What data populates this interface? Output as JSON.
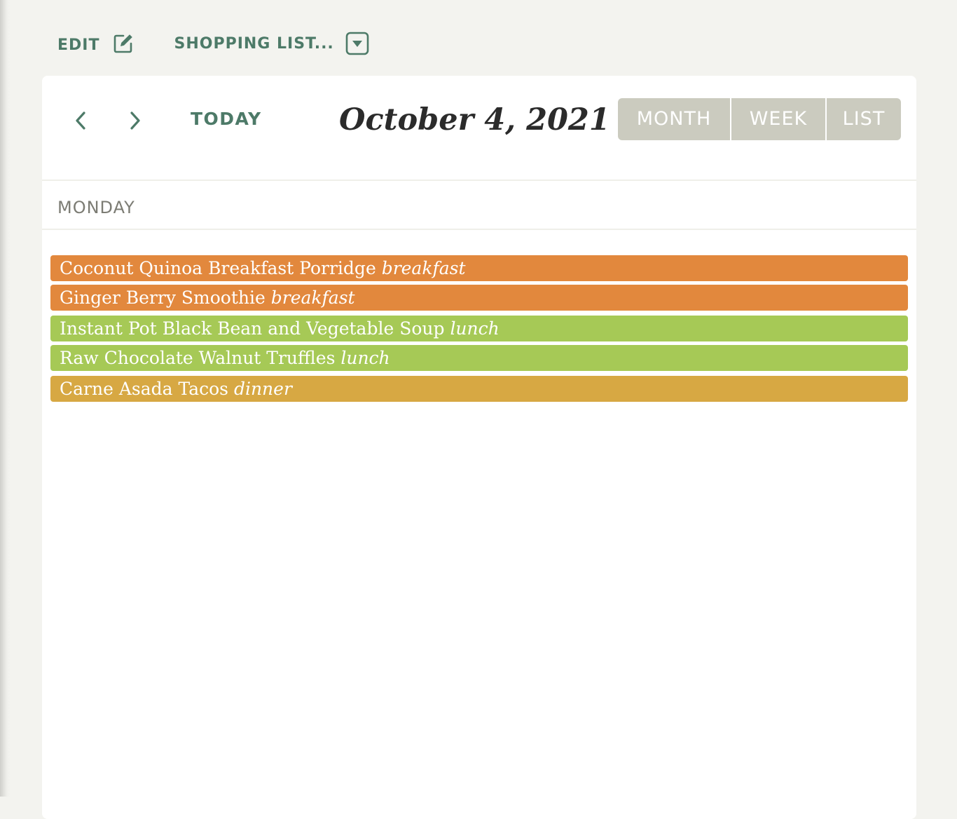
{
  "toolbar": {
    "edit_label": "EDIT",
    "edit_icon": "edit-pencil-icon",
    "shopping_label": "SHOPPING LIST...",
    "shopping_icon": "dropdown-caret-icon"
  },
  "calendar": {
    "today_label": "TODAY",
    "title": "October 4, 2021",
    "views": [
      {
        "label": "MONTH"
      },
      {
        "label": "WEEK"
      },
      {
        "label": "LIST"
      }
    ],
    "day_label": "MONDAY",
    "events": [
      {
        "name": "Coconut Quinoa Breakfast Porridge",
        "meal": "breakfast",
        "color": "#e2883d"
      },
      {
        "name": "Ginger Berry Smoothie",
        "meal": "breakfast",
        "color": "#e2883d"
      },
      {
        "name": "Instant Pot Black Bean and Vegetable Soup",
        "meal": "lunch",
        "color": "#a6c956"
      },
      {
        "name": "Raw Chocolate Walnut Truffles",
        "meal": "lunch",
        "color": "#a6c956"
      },
      {
        "name": "Carne Asada Tacos",
        "meal": "dinner",
        "color": "#d7a843"
      }
    ]
  },
  "colors": {
    "accent": "#4d7a68",
    "view_button_bg": "#cbcbbf",
    "page_bg": "#f3f3ef"
  }
}
